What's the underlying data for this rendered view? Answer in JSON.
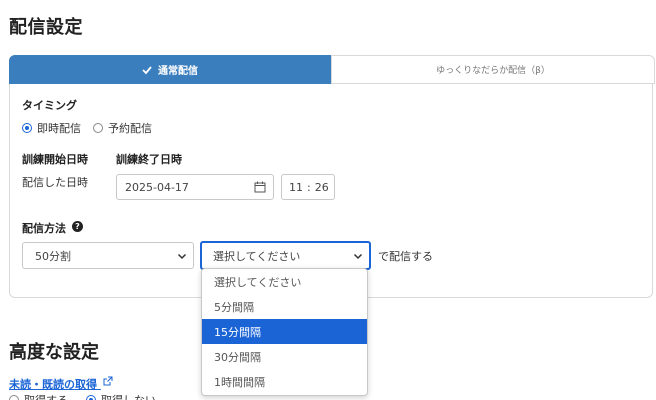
{
  "page": {
    "title": "配信設定"
  },
  "tabs": [
    {
      "label": "通常配信",
      "active": true
    },
    {
      "label": "ゆっくりなだらか配信（β）",
      "active": false
    }
  ],
  "timing": {
    "label": "タイミング",
    "options": [
      {
        "label": "即時配信",
        "checked": true
      },
      {
        "label": "予約配信",
        "checked": false
      }
    ]
  },
  "training": {
    "start_label": "訓練開始日時",
    "end_label": "訓練終了日時",
    "start_value": "配信した日時",
    "end_date": "2025-04-17",
    "end_hour": "11",
    "end_sep": ":",
    "end_minute": "26"
  },
  "delivery": {
    "label": "配信方法",
    "split_value": "50分割",
    "interval_value": "選択してください",
    "suffix": "で配信する",
    "interval_options": [
      "選択してください",
      "5分間隔",
      "15分間隔",
      "30分間隔",
      "1時間間隔"
    ],
    "highlighted_index": 2
  },
  "advanced": {
    "title": "高度な設定",
    "read_link": "未読・既読の取得",
    "read_options": [
      "取得する",
      "取得しない"
    ]
  },
  "colors": {
    "accent": "#3a7ebe",
    "highlight": "#1a64d6"
  }
}
